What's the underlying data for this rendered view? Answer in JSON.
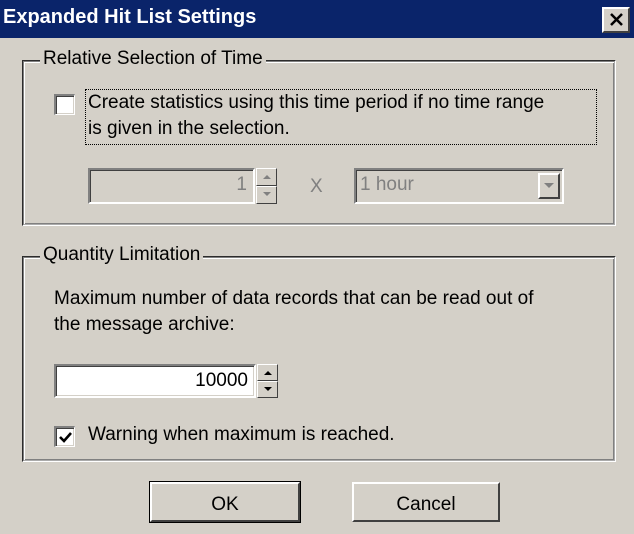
{
  "window": {
    "title": "Expanded Hit List Settings"
  },
  "relative_selection": {
    "group_label": "Relative Selection of Time",
    "checkbox_checked": false,
    "checkbox_text_line1": "Create statistics using this time period if no time range",
    "checkbox_text_line2": "is given in the selection.",
    "count_value": "1",
    "multiply_symbol": "X",
    "unit_value": "1 hour"
  },
  "quantity_limitation": {
    "group_label": "Quantity Limitation",
    "description_line1": "Maximum number of data records that can be read out of",
    "description_line2": "the message archive:",
    "max_records_value": "10000",
    "warning_checked": true,
    "warning_text": "Warning when maximum is reached."
  },
  "buttons": {
    "ok_label": "OK",
    "cancel_label": "Cancel"
  },
  "colors": {
    "titlebar": "#0a246a",
    "face": "#d4d0c8"
  }
}
